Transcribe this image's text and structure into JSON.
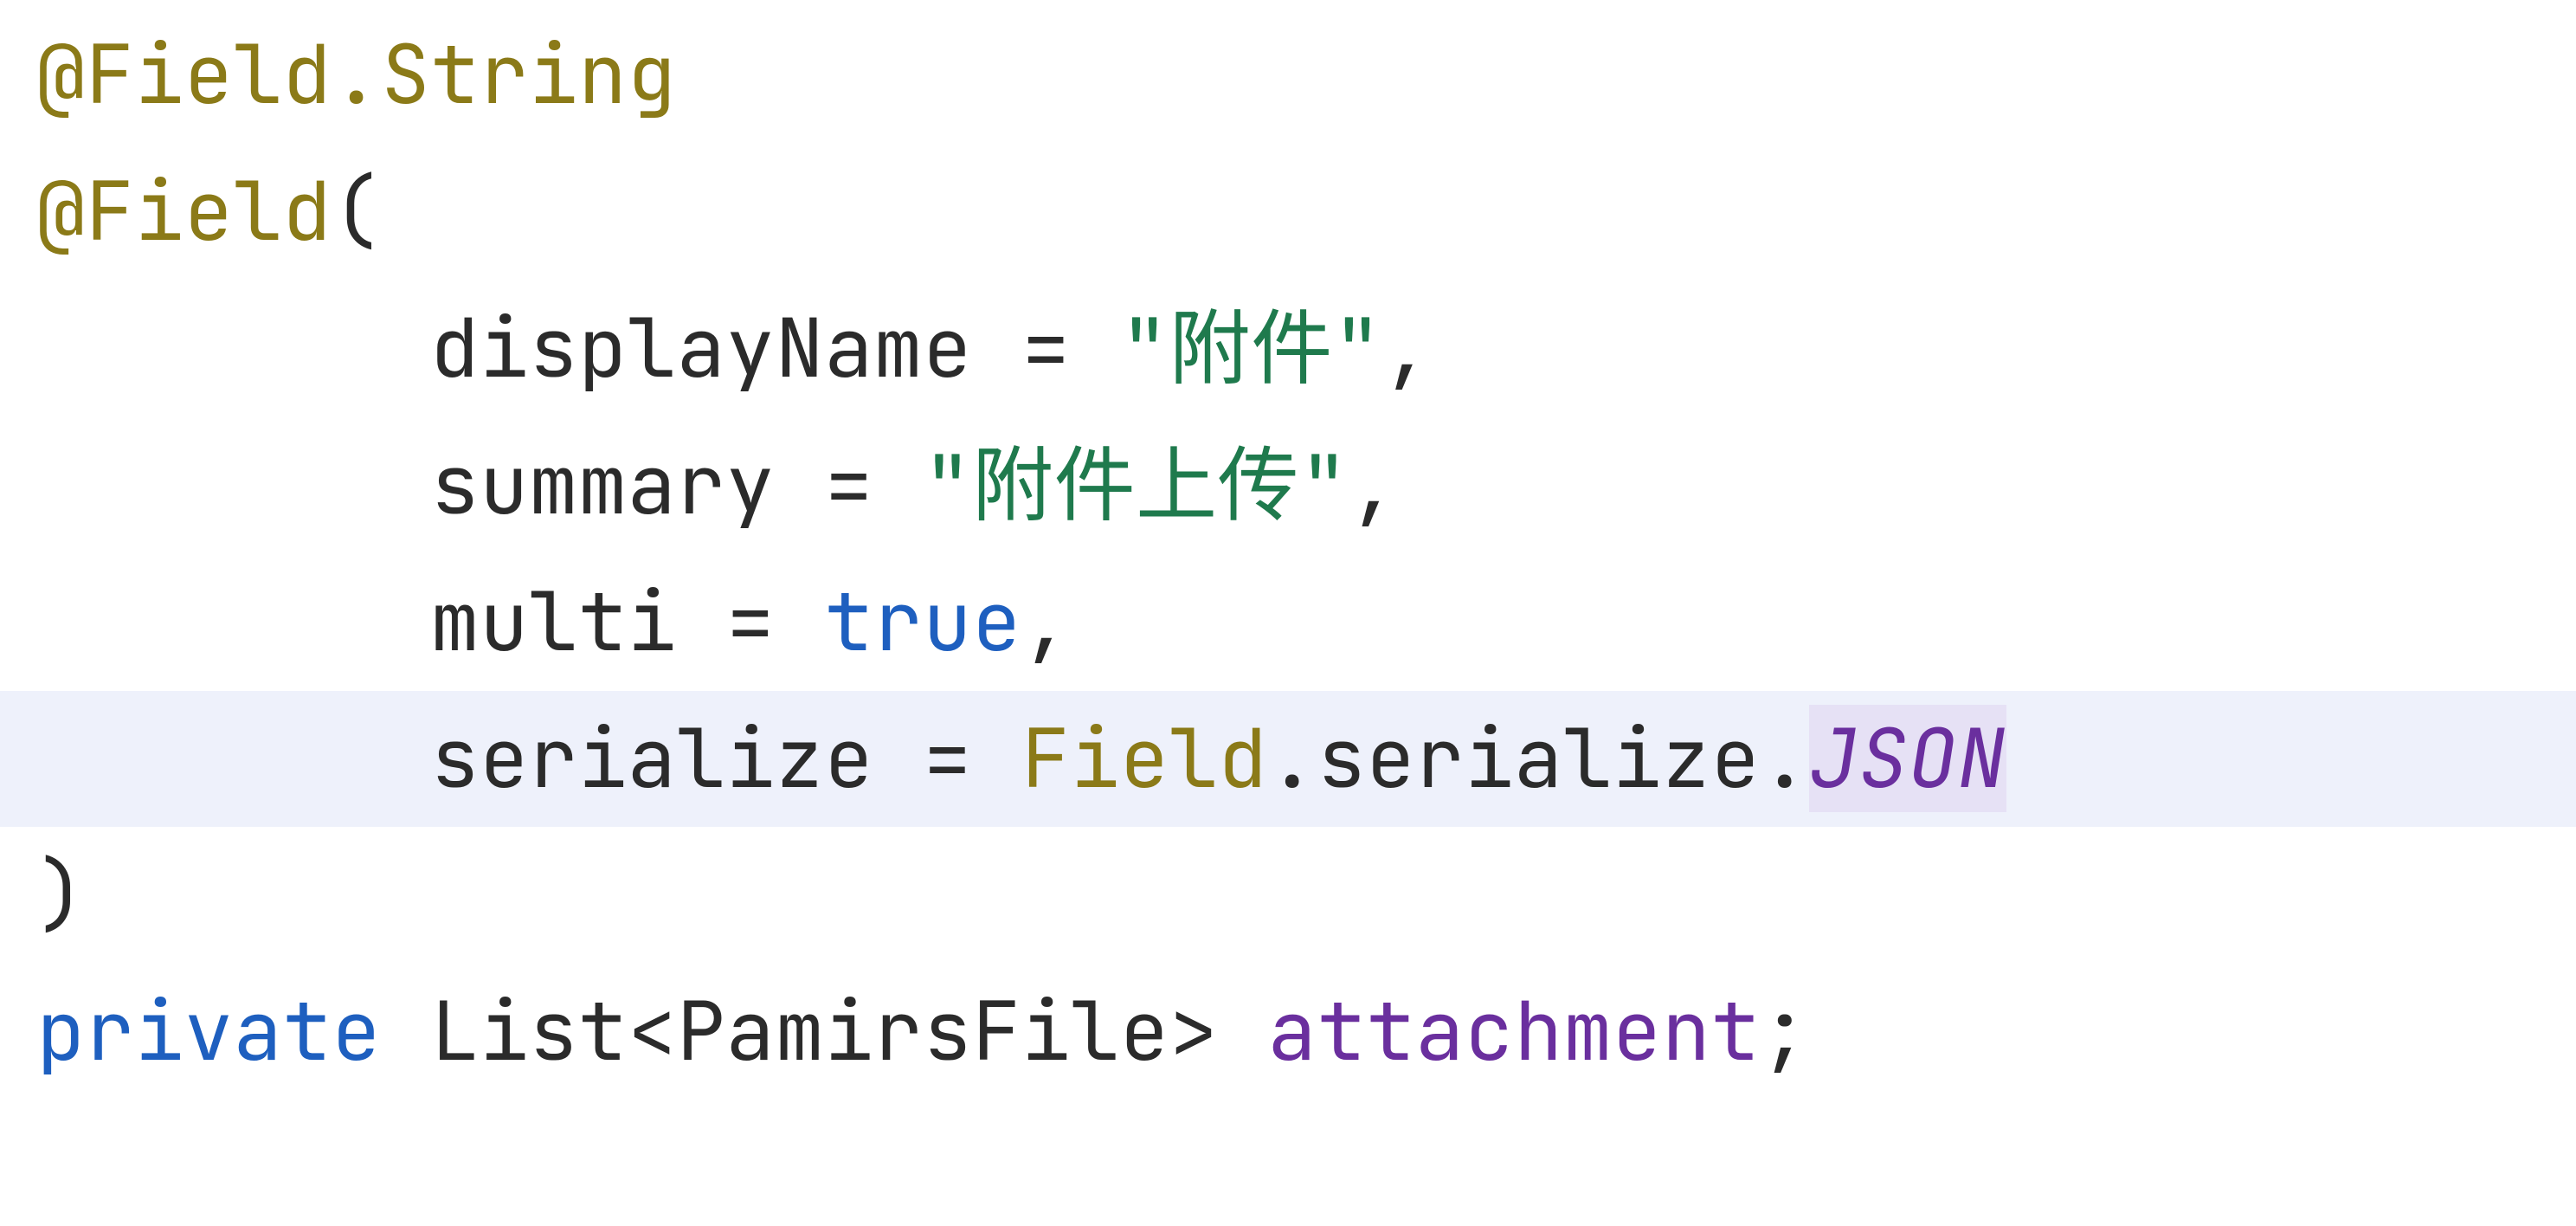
{
  "code": {
    "line1": {
      "at": "@",
      "anno": "Field",
      "dot": ".",
      "sub": "String"
    },
    "line2": {
      "at": "@",
      "anno": "Field",
      "paren": "("
    },
    "line3": {
      "indent": "        ",
      "param": "displayName",
      "eq": " = ",
      "val": "\"附件\"",
      "comma": ","
    },
    "line4": {
      "indent": "        ",
      "param": "summary",
      "eq": " = ",
      "val": "\"附件上传\"",
      "comma": ","
    },
    "line5": {
      "indent": "        ",
      "param": "multi",
      "eq": " = ",
      "val": "true",
      "comma": ","
    },
    "line6": {
      "indent": "        ",
      "param": "serialize",
      "eq": " = ",
      "qual1": "Field",
      "dot1": ".",
      "qual2": "serialize",
      "dot2": ".",
      "const": "JSON"
    },
    "line7": {
      "paren": ")"
    },
    "line8": {
      "access": "private",
      "sp": " ",
      "type": "List",
      "lt": "<",
      "gen": "PamirsFile",
      "gt": ">",
      "sp2": " ",
      "field": "attachment",
      "semi": ";"
    }
  }
}
